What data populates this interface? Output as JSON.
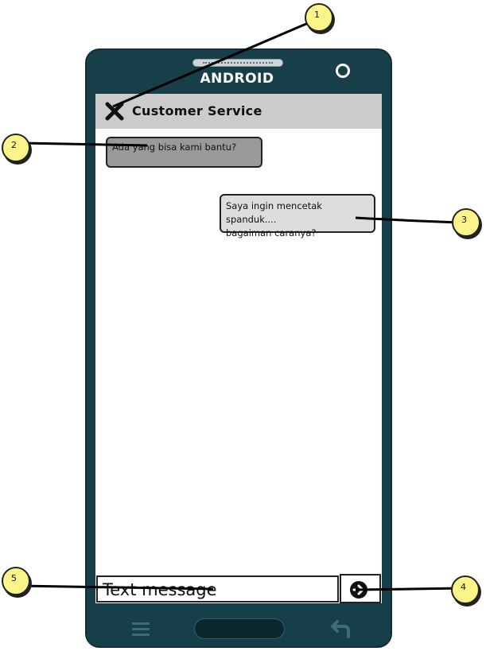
{
  "device": {
    "brand_label": "ANDROID"
  },
  "header": {
    "title": "Customer Service",
    "close_icon": "close-x-icon"
  },
  "messages": [
    {
      "direction": "incoming",
      "text": "Ada yang bisa kami bantu?"
    },
    {
      "direction": "outgoing",
      "lines": [
        "Saya ingin mencetak spanduk....",
        "bagaiman caranya?"
      ]
    }
  ],
  "composer": {
    "placeholder": "Text message",
    "send_icon": "arrow-right-circle-icon"
  },
  "nav_bar": {
    "menu_icon": "menu-icon",
    "home_icon": "home-button",
    "back_icon": "back-arrow-icon"
  },
  "callouts": [
    "1",
    "2",
    "3",
    "4",
    "5"
  ],
  "colors": {
    "phone_body": "#173f4a",
    "title_bar": "#cccccc",
    "incoming_bubble": "#999999",
    "outgoing_bubble": "#dddddd",
    "callout": "#fbf48a"
  }
}
